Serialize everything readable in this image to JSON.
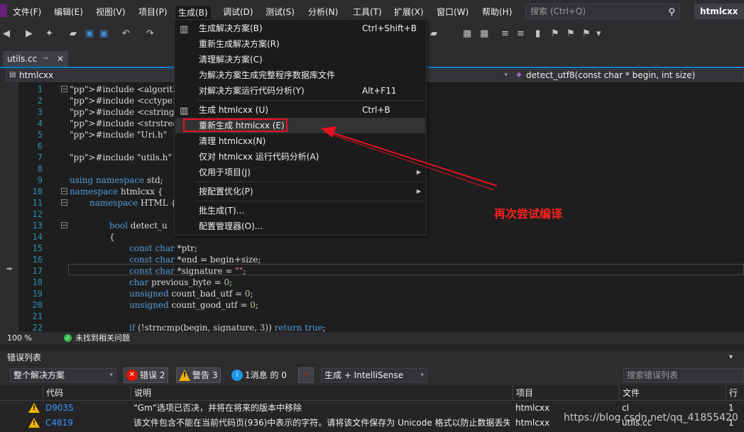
{
  "menubar": {
    "items": [
      "文件(F)",
      "编辑(E)",
      "视图(V)",
      "项目(P)",
      "生成(B)",
      "调试(D)",
      "测试(S)",
      "分析(N)",
      "工具(T)",
      "扩展(X)",
      "窗口(W)",
      "帮助(H)"
    ],
    "active_item": "生成(B)",
    "search_placeholder": "搜索 (Ctrl+Q)",
    "app_title": "htmlcxx"
  },
  "tab": {
    "file_name": "utils.cc"
  },
  "navbar": {
    "project": "htmlcxx",
    "function": "detect_utf8(const char * begin, int size)"
  },
  "build_menu": {
    "items": [
      {
        "label": "生成解决方案(B)",
        "shortcut": "Ctrl+Shift+B",
        "icon": "build-icon"
      },
      {
        "label": "重新生成解决方案(R)",
        "shortcut": ""
      },
      {
        "label": "清理解决方案(C)",
        "shortcut": ""
      },
      {
        "label": "为解决方案生成完整程序数据库文件",
        "shortcut": ""
      },
      {
        "label": "对解决方案运行代码分析(Y)",
        "shortcut": "Alt+F11"
      },
      {
        "label": "生成 htmlcxx (U)",
        "shortcut": "Ctrl+B",
        "icon": "build-icon"
      },
      {
        "label": "重新生成 htmlcxx (E)",
        "shortcut": ""
      },
      {
        "label": "清理 htmlcxx(N)",
        "shortcut": ""
      },
      {
        "label": "仅对 htmlcxx 运行代码分析(A)",
        "shortcut": ""
      },
      {
        "label": "仅用于项目(J)",
        "shortcut": "",
        "submenu": true
      },
      {
        "label": "按配置优化(P)",
        "shortcut": "",
        "submenu": true
      },
      {
        "label": "批生成(T)...",
        "shortcut": ""
      },
      {
        "label": "配置管理器(O)...",
        "shortcut": ""
      }
    ]
  },
  "annotation": {
    "text": "再次尝试编译",
    "color": "#ff2020"
  },
  "code": {
    "lines": [
      {
        "n": "1",
        "t": "#include <algorithm>"
      },
      {
        "n": "2",
        "t": "#include <cctype>"
      },
      {
        "n": "3",
        "t": "#include <cstring>"
      },
      {
        "n": "4",
        "t": "#include <strstream>"
      },
      {
        "n": "5",
        "t": "#include \"Uri.h\""
      },
      {
        "n": "6",
        "t": ""
      },
      {
        "n": "7",
        "t": "#include \"utils.h\""
      },
      {
        "n": "8",
        "t": ""
      },
      {
        "n": "9",
        "t": "using namespace std;"
      },
      {
        "n": "10",
        "t": "namespace htmlcxx {"
      },
      {
        "n": "11",
        "t": "namespace HTML {"
      },
      {
        "n": "12",
        "t": ""
      },
      {
        "n": "13",
        "t": "bool detect_u"
      },
      {
        "n": "14",
        "t": "{"
      },
      {
        "n": "15",
        "t": "const char *ptr;"
      },
      {
        "n": "16",
        "t": "const char *end = begin+size;"
      },
      {
        "n": "17",
        "t": "const char *signature = \"\";"
      },
      {
        "n": "18",
        "t": "char previous_byte = 0;"
      },
      {
        "n": "19",
        "t": "unsigned count_bad_utf = 0;"
      },
      {
        "n": "20",
        "t": "unsigned count_good_utf = 0;"
      },
      {
        "n": "21",
        "t": ""
      },
      {
        "n": "22",
        "t": "if (!strncmp(begin, signature, 3)) return true;"
      }
    ]
  },
  "editor_status": {
    "zoom": "100 %",
    "issues": "未找到相关问题"
  },
  "error_list": {
    "title": "错误列表",
    "scope": "整个解决方案",
    "errors_label": "错误 2",
    "warnings_label": "警告 3",
    "messages_label": "1消息 的 0",
    "source": "生成 + IntelliSense",
    "search_placeholder": "搜索错误列表",
    "columns": [
      "代码",
      "说明",
      "项目",
      "文件",
      "行"
    ],
    "rows": [
      {
        "code": "D9035",
        "desc": "“Gm”选项已否决，并将在将来的版本中移除",
        "project": "htmlcxx",
        "file": "cl",
        "line": "1"
      },
      {
        "code": "C4819",
        "desc": "该文件包含不能在当前代码页(936)中表示的字符。请将该文件保存为 Unicode 格式以防止数据丢失",
        "project": "htmlcxx",
        "file": "utils.cc",
        "line": "1"
      }
    ]
  },
  "watermark": "https://blog.csdn.net/qq_41855420"
}
